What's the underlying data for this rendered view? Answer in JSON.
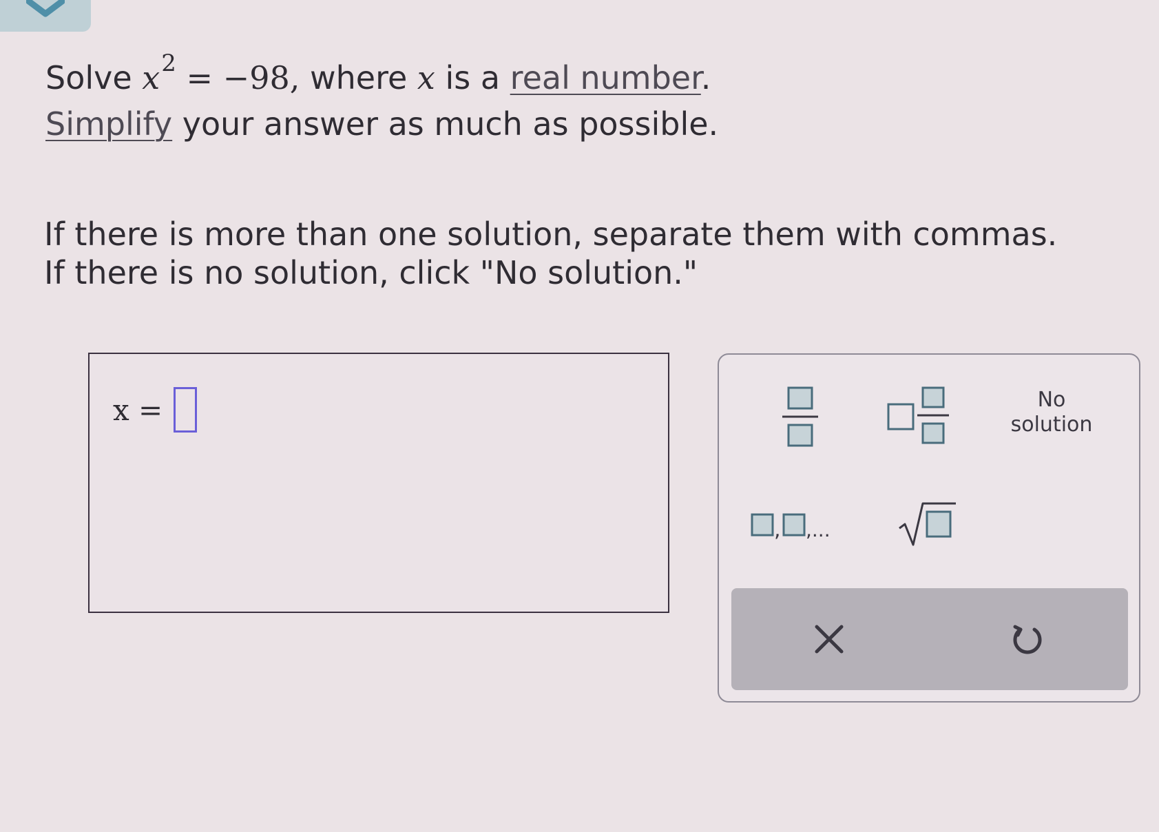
{
  "header": {
    "collapse_icon": "chevron-down-icon"
  },
  "problem": {
    "solve_label": "Solve",
    "variable": "x",
    "exponent": "2",
    "equation_rhs": "= −98,",
    "where_text": "where",
    "variable_again": "x",
    "is_text": "is a",
    "link_real_number": "real number",
    "period": ".",
    "link_simplify": "Simplify",
    "simplify_rest": "your answer as much as possible."
  },
  "instructions": {
    "line1": "If there is more than one solution, separate them with commas.",
    "line2": "If there is no solution, click \"No solution.\""
  },
  "answer": {
    "label": "x =",
    "value": ""
  },
  "palette": {
    "fraction_icon": "fraction-icon",
    "mixed_number_icon": "mixed-number-icon",
    "no_solution_line1": "No",
    "no_solution_line2": "solution",
    "list_icon": "list-separator-icon",
    "list_text": ",",
    "list_ellipsis": ",...",
    "sqrt_icon": "square-root-icon",
    "clear_icon": "close-icon",
    "undo_icon": "undo-icon"
  },
  "colors": {
    "background": "#ebe3e6",
    "template_box_fill": "#c7d3d8",
    "template_box_border": "#496c7c",
    "input_border": "#6a5fd8",
    "action_bar": "#b5b1b8"
  }
}
